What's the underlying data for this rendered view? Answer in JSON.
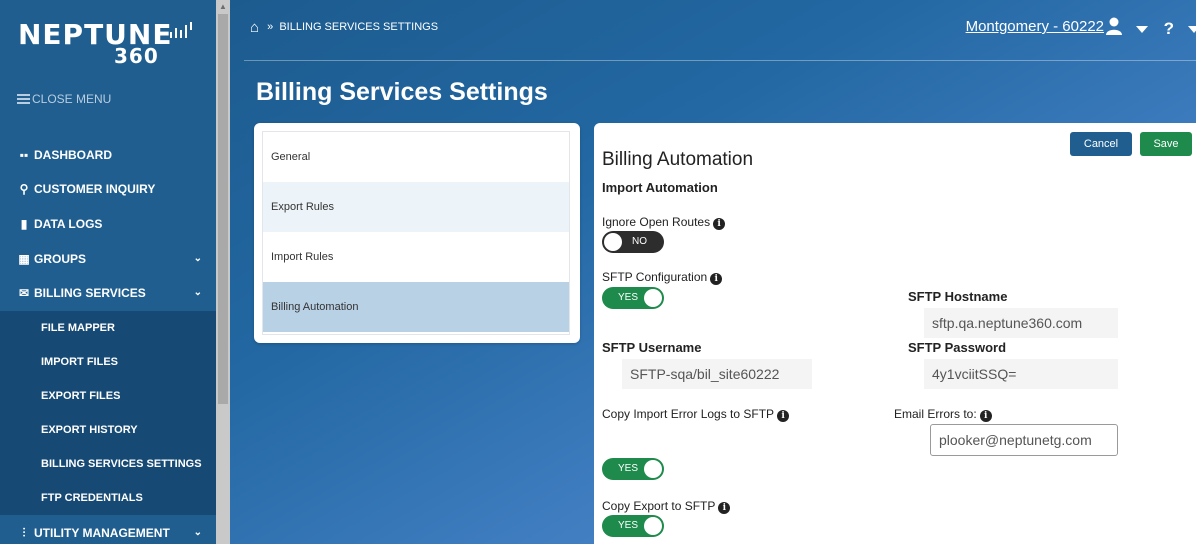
{
  "logo": {
    "text": "NEPTUNE",
    "sub": "360"
  },
  "sidebar": {
    "close_menu": "CLOSE MENU",
    "items": [
      {
        "label": "DASHBOARD",
        "icon": "dashboard-icon"
      },
      {
        "label": "CUSTOMER INQUIRY",
        "icon": "search-icon"
      },
      {
        "label": "DATA LOGS",
        "icon": "bar-chart-icon"
      },
      {
        "label": "GROUPS",
        "icon": "groups-icon"
      },
      {
        "label": "BILLING SERVICES",
        "icon": "envelope-icon"
      },
      {
        "label": "UTILITY MANAGEMENT",
        "icon": "utility-icon"
      }
    ],
    "sub_items": [
      "FILE MAPPER",
      "IMPORT FILES",
      "EXPORT FILES",
      "EXPORT HISTORY",
      "BILLING SERVICES SETTINGS",
      "FTP CREDENTIALS"
    ]
  },
  "header": {
    "breadcrumb_sep": "»",
    "breadcrumb": "BILLING SERVICES SETTINGS",
    "user": "Montgomery - 60222",
    "help": "?"
  },
  "page_title": "Billing Services Settings",
  "tabs": [
    "General",
    "Export Rules",
    "Import Rules",
    "Billing Automation"
  ],
  "active_tab": "Billing Automation",
  "form": {
    "cancel": "Cancel",
    "save": "Save",
    "heading": "Billing Automation",
    "subheading": "Import Automation",
    "ignore_open_routes": {
      "label": "Ignore Open Routes",
      "value": "NO"
    },
    "sftp_configuration": {
      "label": "SFTP Configuration",
      "value": "YES"
    },
    "sftp_hostname": {
      "label": "SFTP Hostname",
      "value": "sftp.qa.neptune360.com"
    },
    "sftp_username": {
      "label": "SFTP Username",
      "value": "SFTP-sqa/bil_site60222"
    },
    "sftp_password": {
      "label": "SFTP Password",
      "value": "4y1vciitSSQ="
    },
    "copy_import_error_logs": {
      "label": "Copy Import Error Logs to SFTP",
      "value": "YES"
    },
    "email_errors_to": {
      "label": "Email Errors to:",
      "value": "plooker@neptunetg.com"
    },
    "copy_export": {
      "label": "Copy Export to SFTP",
      "value": "YES"
    }
  },
  "colors": {
    "sidebar": "#1f5e8f",
    "sidebar_sub": "#164a74",
    "toggle_on": "#1e8a4c",
    "toggle_off": "#2d2d2d",
    "cancel": "#1f5e8f",
    "save": "#1e8a4c",
    "active_tab": "#b9d1e5",
    "alt_tab": "#edf4f9"
  }
}
